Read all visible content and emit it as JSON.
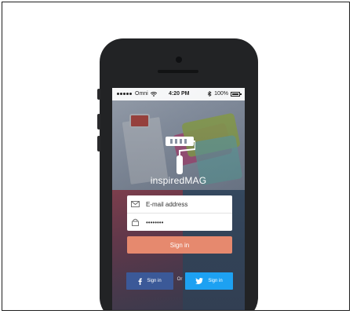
{
  "status_bar": {
    "carrier": "Omni",
    "time": "4:20 PM",
    "battery": "100%"
  },
  "app": {
    "brand_name": "inspiredMAG",
    "logo_icon": "paint-roller-icon"
  },
  "login": {
    "email_placeholder": "E-mail address",
    "password_value": "••••••••",
    "email_icon": "envelope-icon",
    "password_icon": "lock-icon",
    "signin_label": "Sign in"
  },
  "social": {
    "facebook_label": "Sign in",
    "twitter_label": "Sign in",
    "or_text": "Or"
  },
  "colors": {
    "signin_button": "#e6896e",
    "facebook": "#3b5998",
    "twitter": "#1da1f2",
    "phone_body": "#222325"
  }
}
